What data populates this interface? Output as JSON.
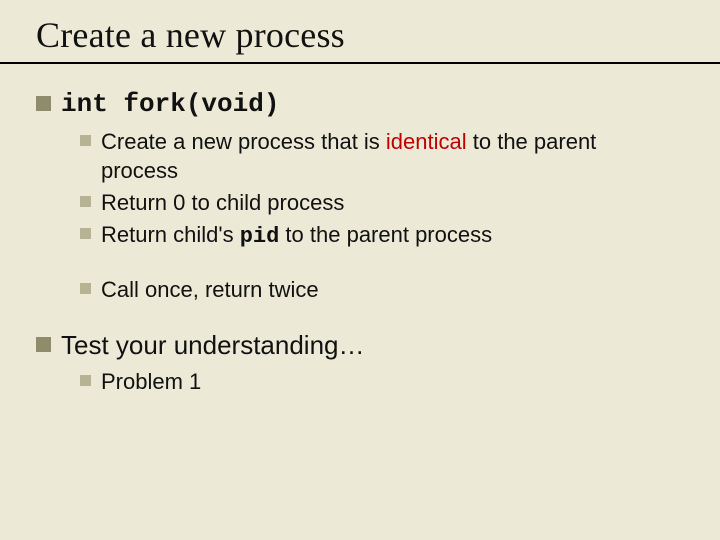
{
  "title": "Create a new process",
  "items": [
    {
      "kind": "code",
      "text": "int fork(void)",
      "children": [
        {
          "segments": [
            {
              "t": "Create a new process that is "
            },
            {
              "t": "identical",
              "red": true
            },
            {
              "t": " to the parent process"
            }
          ]
        },
        {
          "segments": [
            {
              "t": "Return 0 to child process"
            }
          ]
        },
        {
          "segments": [
            {
              "t": "Return child's "
            },
            {
              "t": "pid",
              "mono": true
            },
            {
              "t": " to the parent process"
            }
          ]
        },
        {
          "gapBefore": true,
          "segments": [
            {
              "t": "Call once, return twice"
            }
          ]
        }
      ]
    },
    {
      "gapBefore": true,
      "text": "Test your understanding…",
      "children": [
        {
          "segments": [
            {
              "t": "Problem 1"
            }
          ]
        }
      ]
    }
  ]
}
